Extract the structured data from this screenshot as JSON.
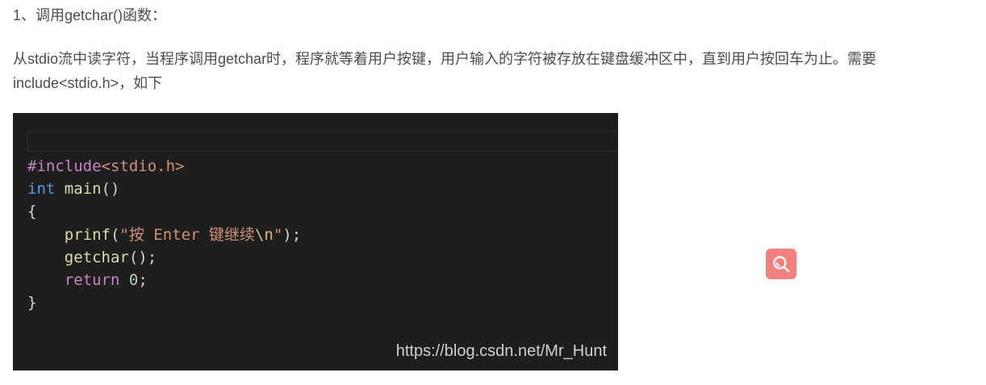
{
  "article": {
    "heading": "1、调用getchar()函数：",
    "paragraph": "从stdio流中读字符，当程序调用getchar时，程序就等着用户按键，用户输入的字符被存放在键盘缓冲区中，直到用户按回车为止。需要include<stdio.h>，如下"
  },
  "code_image": {
    "lines": [
      [
        {
          "t": "#include",
          "k": "directive"
        },
        {
          "t": "<stdio.h>",
          "k": "header"
        }
      ],
      [
        {
          "t": "int",
          "k": "keyword"
        },
        {
          "t": " ",
          "k": "punc"
        },
        {
          "t": "main",
          "k": "func"
        },
        {
          "t": "()",
          "k": "punc"
        }
      ],
      [
        {
          "t": "{",
          "k": "punc"
        }
      ],
      [
        {
          "t": "    ",
          "k": "punc"
        },
        {
          "t": "prinf",
          "k": "func"
        },
        {
          "t": "(",
          "k": "punc"
        },
        {
          "t": "\"按 Enter 键继续",
          "k": "string"
        },
        {
          "t": "\\n",
          "k": "escape"
        },
        {
          "t": "\"",
          "k": "string"
        },
        {
          "t": ");",
          "k": "punc"
        }
      ],
      [
        {
          "t": "    ",
          "k": "punc"
        },
        {
          "t": "getchar",
          "k": "func"
        },
        {
          "t": "();",
          "k": "punc"
        }
      ],
      [
        {
          "t": "    ",
          "k": "punc"
        },
        {
          "t": "return",
          "k": "control"
        },
        {
          "t": " ",
          "k": "punc"
        },
        {
          "t": "0",
          "k": "number"
        },
        {
          "t": ";",
          "k": "punc"
        }
      ],
      [
        {
          "t": "}",
          "k": "punc"
        }
      ]
    ],
    "watermark": "https://blog.csdn.net/Mr_Hunt"
  },
  "search_button": {
    "icon": "search-icon",
    "color": "#f47f7f"
  }
}
